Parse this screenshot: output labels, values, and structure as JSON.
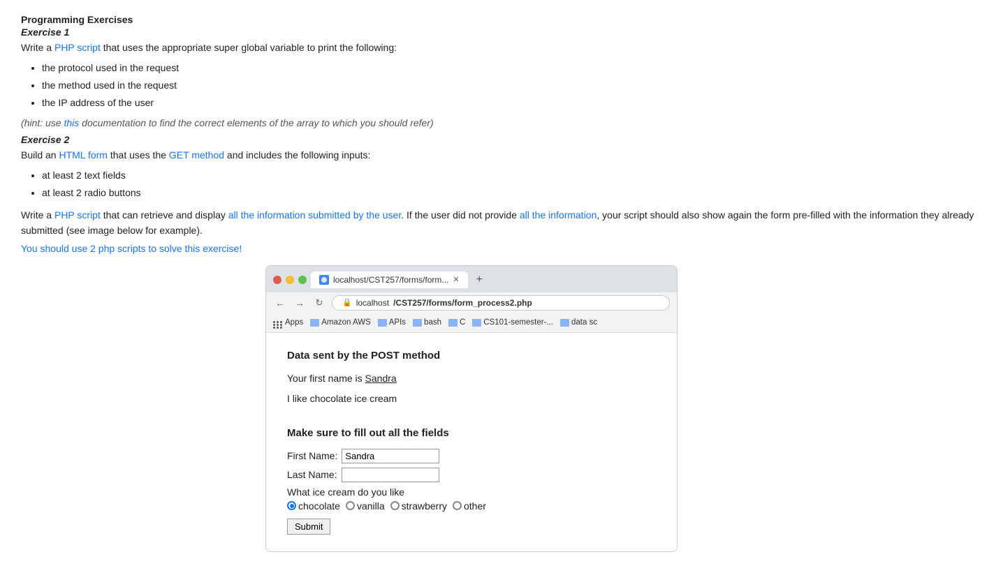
{
  "page": {
    "title": "Programming Exercises",
    "exercise1": {
      "label": "Exercise 1",
      "desc": "Write a PHP script that uses the appropriate super global variable to print the following:",
      "items": [
        "the protocol used in the request",
        "the method used in the request",
        "the IP address of the user"
      ],
      "hint_pre": "(hint: use ",
      "hint_link": "this",
      "hint_post": " documentation to find the correct elements of the array to which you should refer)"
    },
    "exercise2": {
      "label": "Exercise 2",
      "desc": "Build an HTML form that uses the GET method and includes the following inputs:",
      "items": [
        "at least 2 text fields",
        "at least 2 radio buttons"
      ],
      "long_text": "Write a PHP script that can retrieve and display all the information submitted by the user. If the user did not provide all the information, your script should also show again the form pre-filled with the information they already submitted (see image below for example).",
      "you_should": "You should use 2 php scripts to solve this exercise!"
    }
  },
  "browser": {
    "tab_url": "localhost/CST257/forms/form...",
    "address_bar_pre": "localhost",
    "address_bar_bold": "/CST257/forms/form_process2.php",
    "bookmarks": [
      "Apps",
      "Amazon AWS",
      "APIs",
      "bash",
      "C",
      "CS101-semester-...",
      "data sc"
    ],
    "content": {
      "heading": "Data sent by the POST method",
      "first_name_line_pre": "Your first name is ",
      "first_name_value": "Sandra",
      "ice_cream_line": "I like chocolate ice cream",
      "warning": "Make sure to fill out all the fields",
      "form": {
        "first_name_label": "First Name:",
        "first_name_value": "Sandra",
        "last_name_label": "Last Name:",
        "last_name_value": "",
        "ice_cream_label": "What ice cream do you like",
        "options": [
          "chocolate",
          "vanilla",
          "strawberry",
          "other"
        ],
        "selected_option": "chocolate",
        "submit_label": "Submit"
      }
    }
  }
}
